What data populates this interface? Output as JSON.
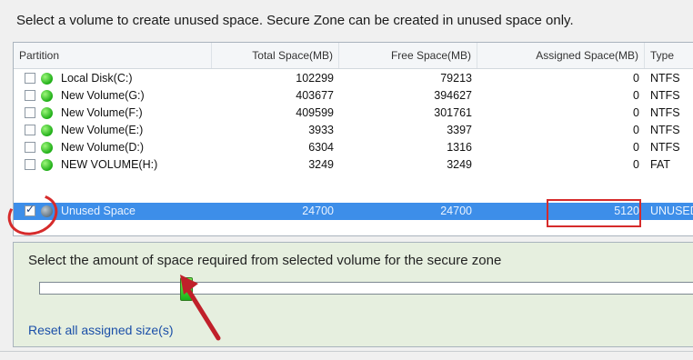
{
  "instruction": "Select a volume to create unused space. Secure Zone can be created in unused space only.",
  "table": {
    "headers": {
      "partition": "Partition",
      "total": "Total Space(MB)",
      "free": "Free Space(MB)",
      "assigned": "Assigned Space(MB)",
      "type": "Type"
    },
    "rows": [
      {
        "name": "Local Disk(C:)",
        "total": "102299",
        "free": "79213",
        "assigned": "0",
        "type": "NTFS",
        "checked": false,
        "icon": "green-disk-icon"
      },
      {
        "name": "New Volume(G:)",
        "total": "403677",
        "free": "394627",
        "assigned": "0",
        "type": "NTFS",
        "checked": false,
        "icon": "green-disk-icon"
      },
      {
        "name": "New Volume(F:)",
        "total": "409599",
        "free": "301761",
        "assigned": "0",
        "type": "NTFS",
        "checked": false,
        "icon": "green-disk-icon"
      },
      {
        "name": "New Volume(E:)",
        "total": "3933",
        "free": "3397",
        "assigned": "0",
        "type": "NTFS",
        "checked": false,
        "icon": "green-disk-icon"
      },
      {
        "name": "New Volume(D:)",
        "total": "6304",
        "free": "1316",
        "assigned": "0",
        "type": "NTFS",
        "checked": false,
        "icon": "green-disk-icon"
      },
      {
        "name": "NEW VOLUME(H:)",
        "total": "3249",
        "free": "3249",
        "assigned": "0",
        "type": "FAT",
        "checked": false,
        "icon": "green-disk-icon"
      },
      {
        "name": "Unused Space",
        "total": "24700",
        "free": "24700",
        "assigned": "5120",
        "type": "UNUSED",
        "checked": true,
        "icon": "gray-disk-icon"
      }
    ]
  },
  "panel": {
    "label": "Select the amount of space required from selected volume for the secure zone",
    "reset_link": "Reset all assigned size(s)"
  },
  "slider": {
    "value_fraction": 0.22
  },
  "colors": {
    "selection": "#3d8ee9",
    "annotation": "#d62b2b",
    "panel_bg": "#e6efdf",
    "link": "#1b4fa8"
  }
}
